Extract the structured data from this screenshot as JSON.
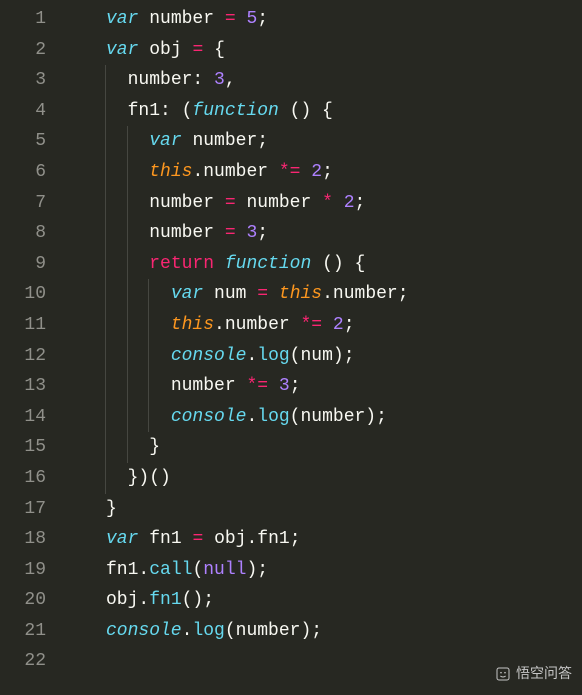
{
  "lines": [
    {
      "n": 1,
      "indent": 0,
      "tokens": [
        [
          "stor",
          "var"
        ],
        [
          "punc",
          " "
        ],
        [
          "prop",
          "number"
        ],
        [
          "punc",
          " "
        ],
        [
          "op",
          "="
        ],
        [
          "punc",
          " "
        ],
        [
          "num",
          "5"
        ],
        [
          "punc",
          ";"
        ]
      ]
    },
    {
      "n": 2,
      "indent": 0,
      "tokens": [
        [
          "stor",
          "var"
        ],
        [
          "punc",
          " "
        ],
        [
          "prop",
          "obj"
        ],
        [
          "punc",
          " "
        ],
        [
          "op",
          "="
        ],
        [
          "punc",
          " "
        ],
        [
          "punc",
          "{"
        ]
      ]
    },
    {
      "n": 3,
      "indent": 1,
      "tokens": [
        [
          "prop",
          "number"
        ],
        [
          "punc",
          ": "
        ],
        [
          "num",
          "3"
        ],
        [
          "punc",
          ","
        ]
      ]
    },
    {
      "n": 4,
      "indent": 1,
      "tokens": [
        [
          "prop",
          "fn1"
        ],
        [
          "punc",
          ": ("
        ],
        [
          "fn",
          "function"
        ],
        [
          "punc",
          " () {"
        ]
      ]
    },
    {
      "n": 5,
      "indent": 2,
      "tokens": [
        [
          "stor",
          "var"
        ],
        [
          "punc",
          " "
        ],
        [
          "prop",
          "number"
        ],
        [
          "punc",
          ";"
        ]
      ]
    },
    {
      "n": 6,
      "indent": 2,
      "tokens": [
        [
          "this",
          "this"
        ],
        [
          "punc",
          "."
        ],
        [
          "prop",
          "number"
        ],
        [
          "punc",
          " "
        ],
        [
          "op",
          "*="
        ],
        [
          "punc",
          " "
        ],
        [
          "num",
          "2"
        ],
        [
          "punc",
          ";"
        ]
      ]
    },
    {
      "n": 7,
      "indent": 2,
      "tokens": [
        [
          "prop",
          "number"
        ],
        [
          "punc",
          " "
        ],
        [
          "op",
          "="
        ],
        [
          "punc",
          " "
        ],
        [
          "prop",
          "number"
        ],
        [
          "punc",
          " "
        ],
        [
          "op",
          "*"
        ],
        [
          "punc",
          " "
        ],
        [
          "num",
          "2"
        ],
        [
          "punc",
          ";"
        ]
      ]
    },
    {
      "n": 8,
      "indent": 2,
      "tokens": [
        [
          "prop",
          "number"
        ],
        [
          "punc",
          " "
        ],
        [
          "op",
          "="
        ],
        [
          "punc",
          " "
        ],
        [
          "num",
          "3"
        ],
        [
          "punc",
          ";"
        ]
      ]
    },
    {
      "n": 9,
      "indent": 2,
      "tokens": [
        [
          "kw",
          "return"
        ],
        [
          "punc",
          " "
        ],
        [
          "fn",
          "function"
        ],
        [
          "punc",
          " () {"
        ]
      ]
    },
    {
      "n": 10,
      "indent": 3,
      "tokens": [
        [
          "stor",
          "var"
        ],
        [
          "punc",
          " "
        ],
        [
          "prop",
          "num"
        ],
        [
          "punc",
          " "
        ],
        [
          "op",
          "="
        ],
        [
          "punc",
          " "
        ],
        [
          "this",
          "this"
        ],
        [
          "punc",
          "."
        ],
        [
          "prop",
          "number"
        ],
        [
          "punc",
          ";"
        ]
      ]
    },
    {
      "n": 11,
      "indent": 3,
      "tokens": [
        [
          "this",
          "this"
        ],
        [
          "punc",
          "."
        ],
        [
          "prop",
          "number"
        ],
        [
          "punc",
          " "
        ],
        [
          "op",
          "*="
        ],
        [
          "punc",
          " "
        ],
        [
          "num",
          "2"
        ],
        [
          "punc",
          ";"
        ]
      ]
    },
    {
      "n": 12,
      "indent": 3,
      "tokens": [
        [
          "obj",
          "console"
        ],
        [
          "punc",
          "."
        ],
        [
          "call",
          "log"
        ],
        [
          "punc",
          "("
        ],
        [
          "prop",
          "num"
        ],
        [
          "punc",
          ");"
        ]
      ]
    },
    {
      "n": 13,
      "indent": 3,
      "tokens": [
        [
          "prop",
          "number"
        ],
        [
          "punc",
          " "
        ],
        [
          "op",
          "*="
        ],
        [
          "punc",
          " "
        ],
        [
          "num",
          "3"
        ],
        [
          "punc",
          ";"
        ]
      ]
    },
    {
      "n": 14,
      "indent": 3,
      "tokens": [
        [
          "obj",
          "console"
        ],
        [
          "punc",
          "."
        ],
        [
          "call",
          "log"
        ],
        [
          "punc",
          "("
        ],
        [
          "prop",
          "number"
        ],
        [
          "punc",
          ");"
        ]
      ]
    },
    {
      "n": 15,
      "indent": 2,
      "tokens": [
        [
          "punc",
          "}"
        ]
      ]
    },
    {
      "n": 16,
      "indent": 1,
      "tokens": [
        [
          "punc",
          "})()"
        ]
      ]
    },
    {
      "n": 17,
      "indent": 0,
      "tokens": [
        [
          "punc",
          "}"
        ]
      ]
    },
    {
      "n": 18,
      "indent": 0,
      "tokens": [
        [
          "stor",
          "var"
        ],
        [
          "punc",
          " "
        ],
        [
          "prop",
          "fn1"
        ],
        [
          "punc",
          " "
        ],
        [
          "op",
          "="
        ],
        [
          "punc",
          " "
        ],
        [
          "prop",
          "obj"
        ],
        [
          "punc",
          "."
        ],
        [
          "prop",
          "fn1"
        ],
        [
          "punc",
          ";"
        ]
      ]
    },
    {
      "n": 19,
      "indent": 0,
      "tokens": [
        [
          "prop",
          "fn1"
        ],
        [
          "punc",
          "."
        ],
        [
          "call",
          "call"
        ],
        [
          "punc",
          "("
        ],
        [
          "null",
          "null"
        ],
        [
          "punc",
          ");"
        ]
      ]
    },
    {
      "n": 20,
      "indent": 0,
      "tokens": [
        [
          "prop",
          "obj"
        ],
        [
          "punc",
          "."
        ],
        [
          "call",
          "fn1"
        ],
        [
          "punc",
          "();"
        ]
      ]
    },
    {
      "n": 21,
      "indent": 0,
      "tokens": [
        [
          "obj",
          "console"
        ],
        [
          "punc",
          "."
        ],
        [
          "call",
          "log"
        ],
        [
          "punc",
          "("
        ],
        [
          "prop",
          "number"
        ],
        [
          "punc",
          ");"
        ]
      ]
    },
    {
      "n": 22,
      "indent": 0,
      "tokens": []
    }
  ],
  "watermark": "悟空问答"
}
